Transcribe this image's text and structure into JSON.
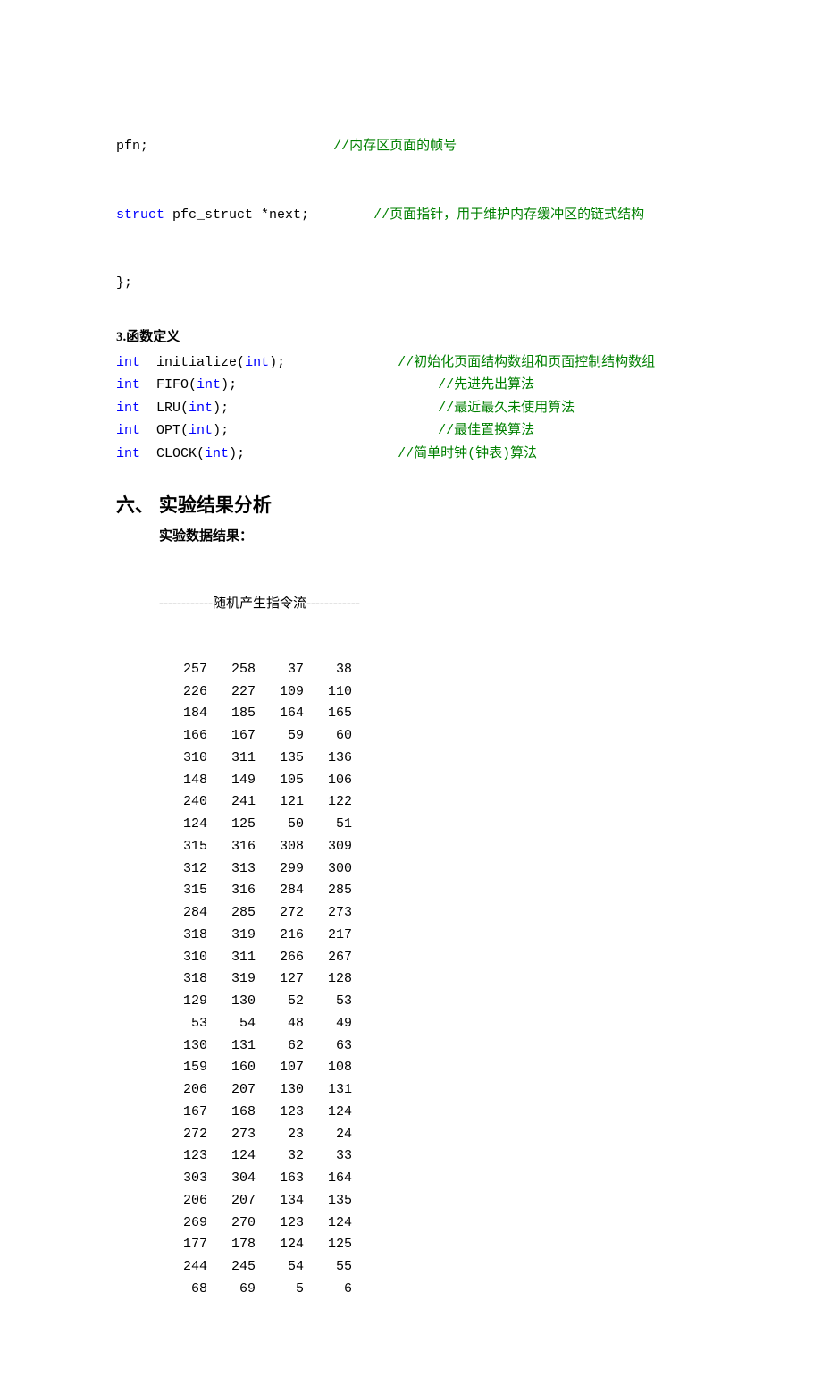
{
  "struct": {
    "line1_field": "pfn;",
    "line1_cmt": "//内存区页面的帧号",
    "line2_kw": "struct",
    "line2_field": " pfc_struct *next;",
    "line2_cmt": "//页面指针，用于维护内存缓冲区的链式结构",
    "line3": "};"
  },
  "funcdef": {
    "heading": "3.函数定义",
    "rows": [
      {
        "ret": "int",
        "sp1": "  ",
        "name": "initialize(",
        "arg": "int",
        "close": ");",
        "pad": "              ",
        "cmt": "//初始化页面结构数组和页面控制结构数组"
      },
      {
        "ret": "int",
        "sp1": "  ",
        "name": "FIFO(",
        "arg": "int",
        "close": ");",
        "pad": "                         ",
        "cmt": "//先进先出算法"
      },
      {
        "ret": "int",
        "sp1": "  ",
        "name": "LRU(",
        "arg": "int",
        "close": ");",
        "pad": "                          ",
        "cmt": "//最近最久未使用算法"
      },
      {
        "ret": "int",
        "sp1": "  ",
        "name": "OPT(",
        "arg": "int",
        "close": ");",
        "pad": "                          ",
        "cmt": "//最佳置换算法"
      },
      {
        "ret": "int",
        "sp1": "  ",
        "name": "CLOCK(",
        "arg": "int",
        "close": ");",
        "pad": "                   ",
        "cmt": "//简单时钟(钟表)算法"
      }
    ]
  },
  "section6": {
    "heading": "六、 实验结果分析",
    "subheading": "实验数据结果：",
    "stream_title": "------------随机产生指令流------------",
    "rows": [
      [
        257,
        258,
        37,
        38
      ],
      [
        226,
        227,
        109,
        110
      ],
      [
        184,
        185,
        164,
        165
      ],
      [
        166,
        167,
        59,
        60
      ],
      [
        310,
        311,
        135,
        136
      ],
      [
        148,
        149,
        105,
        106
      ],
      [
        240,
        241,
        121,
        122
      ],
      [
        124,
        125,
        50,
        51
      ],
      [
        315,
        316,
        308,
        309
      ],
      [
        312,
        313,
        299,
        300
      ],
      [
        315,
        316,
        284,
        285
      ],
      [
        284,
        285,
        272,
        273
      ],
      [
        318,
        319,
        216,
        217
      ],
      [
        310,
        311,
        266,
        267
      ],
      [
        318,
        319,
        127,
        128
      ],
      [
        129,
        130,
        52,
        53
      ],
      [
        53,
        54,
        48,
        49
      ],
      [
        130,
        131,
        62,
        63
      ],
      [
        159,
        160,
        107,
        108
      ],
      [
        206,
        207,
        130,
        131
      ],
      [
        167,
        168,
        123,
        124
      ],
      [
        272,
        273,
        23,
        24
      ],
      [
        123,
        124,
        32,
        33
      ],
      [
        303,
        304,
        163,
        164
      ],
      [
        206,
        207,
        134,
        135
      ],
      [
        269,
        270,
        123,
        124
      ],
      [
        177,
        178,
        124,
        125
      ],
      [
        244,
        245,
        54,
        55
      ],
      [
        68,
        69,
        5,
        6
      ]
    ]
  }
}
